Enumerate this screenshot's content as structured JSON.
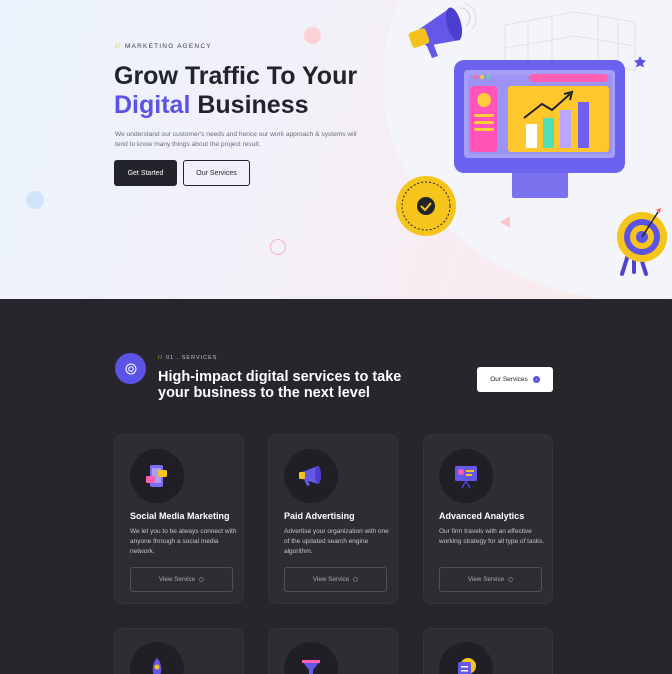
{
  "hero": {
    "eyebrow": "MARKETING AGENCY",
    "title_line1": "Grow Traffic To Your",
    "title_highlight": "Digital",
    "title_rest": " Business",
    "description": "We understand our customer's needs and hence our work approach & systems will tend to know many things about the project result.",
    "primary_button": "Get Started",
    "secondary_button": "Our Services"
  },
  "services": {
    "eyebrow": "01 . SERVICES",
    "title": "High-impact digital services to take your business to the next level",
    "button": "Our Services",
    "cards": [
      {
        "title": "Social Media Marketing",
        "description": "We let you to be always connect with anyone through a social media network.",
        "button": "View Service",
        "icon": "phone-chat-icon"
      },
      {
        "title": "Paid Advertising",
        "description": "Advertise your organization with one of the updated search engine algorithm.",
        "button": "View Service",
        "icon": "megaphone-icon"
      },
      {
        "title": "Advanced Analytics",
        "description": "Our firm travels with an effective working strategy for all type of tasks.",
        "button": "View Service",
        "icon": "presentation-board-icon"
      }
    ],
    "second_row_icons": [
      "rocket-icon",
      "funnel-icon",
      "checklist-icon"
    ]
  },
  "colors": {
    "accent": "#5b52e6",
    "dark": "#23232b",
    "yellow": "#f0c419",
    "section_bg": "#26262c"
  }
}
